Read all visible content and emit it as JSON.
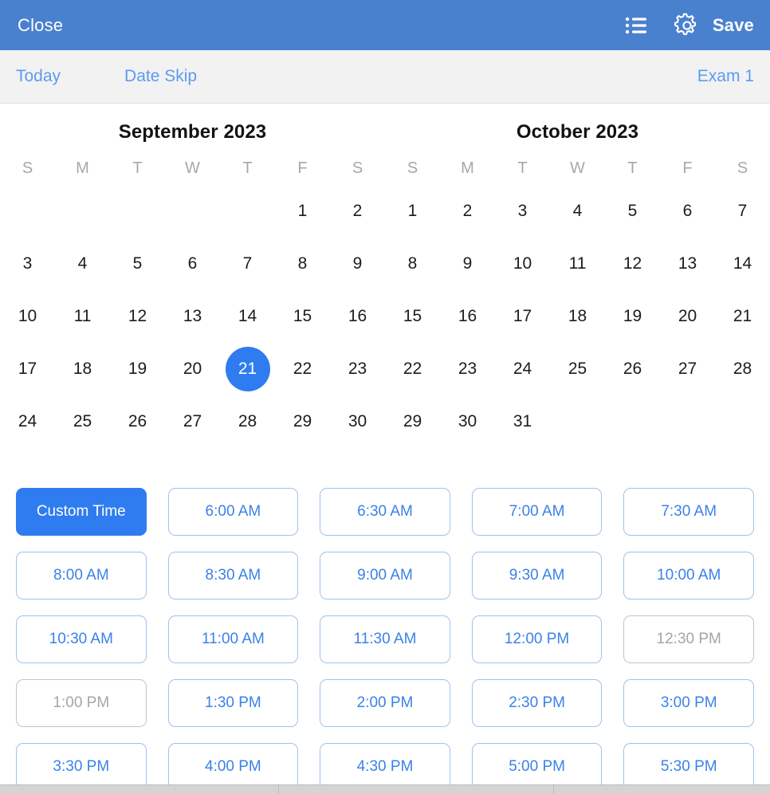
{
  "navbar": {
    "close_label": "Close",
    "save_label": "Save",
    "list_icon": "list-icon",
    "settings_icon": "gear-icon",
    "background_color": "#4a81ce"
  },
  "toolbar": {
    "today_label": "Today",
    "date_skip_label": "Date Skip",
    "exam_label": "Exam 1",
    "link_color": "#5b9bf0",
    "background_color": "#f2f2f2"
  },
  "calendar": {
    "selected_day": 21,
    "selected_month": "September 2023",
    "accent_color": "#2f7cf0",
    "weekday_headers": [
      "S",
      "M",
      "T",
      "W",
      "T",
      "F",
      "S"
    ],
    "months": [
      {
        "title": "September 2023",
        "lead_blanks": 5,
        "days": [
          1,
          2,
          3,
          4,
          5,
          6,
          7,
          8,
          9,
          10,
          11,
          12,
          13,
          14,
          15,
          16,
          17,
          18,
          19,
          20,
          21,
          22,
          23,
          24,
          25,
          26,
          27,
          28,
          29,
          30
        ],
        "selected": 21
      },
      {
        "title": "October 2023",
        "lead_blanks": 0,
        "days": [
          1,
          2,
          3,
          4,
          5,
          6,
          7,
          8,
          9,
          10,
          11,
          12,
          13,
          14,
          15,
          16,
          17,
          18,
          19,
          20,
          21,
          22,
          23,
          24,
          25,
          26,
          27,
          28,
          29,
          30,
          31
        ],
        "selected": null
      }
    ]
  },
  "time_slots": [
    {
      "label": "Custom Time",
      "state": "primary"
    },
    {
      "label": "6:00 AM",
      "state": "enabled"
    },
    {
      "label": "6:30 AM",
      "state": "enabled"
    },
    {
      "label": "7:00 AM",
      "state": "enabled"
    },
    {
      "label": "7:30 AM",
      "state": "enabled"
    },
    {
      "label": "8:00 AM",
      "state": "enabled"
    },
    {
      "label": "8:30 AM",
      "state": "enabled"
    },
    {
      "label": "9:00 AM",
      "state": "enabled"
    },
    {
      "label": "9:30 AM",
      "state": "enabled"
    },
    {
      "label": "10:00 AM",
      "state": "enabled"
    },
    {
      "label": "10:30 AM",
      "state": "enabled"
    },
    {
      "label": "11:00 AM",
      "state": "enabled"
    },
    {
      "label": "11:30 AM",
      "state": "enabled"
    },
    {
      "label": "12:00 PM",
      "state": "enabled"
    },
    {
      "label": "12:30 PM",
      "state": "disabled"
    },
    {
      "label": "1:00 PM",
      "state": "disabled"
    },
    {
      "label": "1:30 PM",
      "state": "enabled"
    },
    {
      "label": "2:00 PM",
      "state": "enabled"
    },
    {
      "label": "2:30 PM",
      "state": "enabled"
    },
    {
      "label": "3:00 PM",
      "state": "enabled"
    },
    {
      "label": "3:30 PM",
      "state": "enabled"
    },
    {
      "label": "4:00 PM",
      "state": "enabled"
    },
    {
      "label": "4:30 PM",
      "state": "enabled"
    },
    {
      "label": "5:00 PM",
      "state": "enabled"
    },
    {
      "label": "5:30 PM",
      "state": "enabled"
    }
  ]
}
